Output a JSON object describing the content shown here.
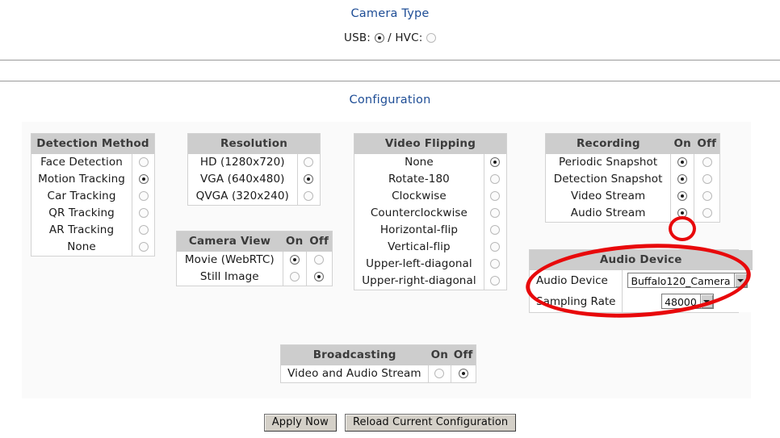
{
  "page": {
    "camera_type_heading": "Camera Type",
    "configuration_heading": "Configuration"
  },
  "camera_type": {
    "usb_label": "USB:",
    "separator": "/",
    "hvc_label": "HVC:",
    "usb_selected": true,
    "hvc_selected": false
  },
  "panels": {
    "detection_method": {
      "title": "Detection Method",
      "rows": [
        {
          "label": "Face Detection",
          "selected": false
        },
        {
          "label": "Motion Tracking",
          "selected": true
        },
        {
          "label": "Car Tracking",
          "selected": false
        },
        {
          "label": "QR Tracking",
          "selected": false
        },
        {
          "label": "AR Tracking",
          "selected": false
        },
        {
          "label": "None",
          "selected": false
        }
      ]
    },
    "resolution": {
      "title": "Resolution",
      "rows": [
        {
          "label": "HD (1280x720)",
          "selected": false
        },
        {
          "label": "VGA (640x480)",
          "selected": true
        },
        {
          "label": "QVGA (320x240)",
          "selected": false
        }
      ]
    },
    "camera_view": {
      "title": "Camera View",
      "col_on": "On",
      "col_off": "Off",
      "rows": [
        {
          "label": "Movie (WebRTC)",
          "on": true,
          "off": false
        },
        {
          "label": "Still Image",
          "on": false,
          "off": true
        }
      ]
    },
    "video_flipping": {
      "title": "Video Flipping",
      "rows": [
        {
          "label": "None",
          "selected": true
        },
        {
          "label": "Rotate-180",
          "selected": false
        },
        {
          "label": "Clockwise",
          "selected": false
        },
        {
          "label": "Counterclockwise",
          "selected": false
        },
        {
          "label": "Horizontal-flip",
          "selected": false
        },
        {
          "label": "Vertical-flip",
          "selected": false
        },
        {
          "label": "Upper-left-diagonal",
          "selected": false
        },
        {
          "label": "Upper-right-diagonal",
          "selected": false
        }
      ]
    },
    "recording": {
      "title": "Recording",
      "col_on": "On",
      "col_off": "Off",
      "rows": [
        {
          "label": "Periodic Snapshot",
          "on": true,
          "off": false
        },
        {
          "label": "Detection Snapshot",
          "on": true,
          "off": false
        },
        {
          "label": "Video Stream",
          "on": true,
          "off": false
        },
        {
          "label": "Audio Stream",
          "on": true,
          "off": false
        }
      ]
    },
    "audio_device": {
      "title": "Audio Device",
      "device_label": "Audio Device",
      "device_value": "Buffalo120_Camera",
      "sampling_label": "Sampling Rate",
      "sampling_value": "48000"
    },
    "broadcasting": {
      "title": "Broadcasting",
      "col_on": "On",
      "col_off": "Off",
      "rows": [
        {
          "label": "Video and Audio Stream",
          "on": false,
          "off": true
        }
      ]
    }
  },
  "buttons": {
    "apply": "Apply Now",
    "reload": "Reload Current Configuration"
  },
  "annotations": {
    "color": "#e8090b",
    "items": [
      {
        "name": "audio-stream-on-radio-highlight"
      },
      {
        "name": "audio-device-panel-highlight"
      }
    ]
  }
}
